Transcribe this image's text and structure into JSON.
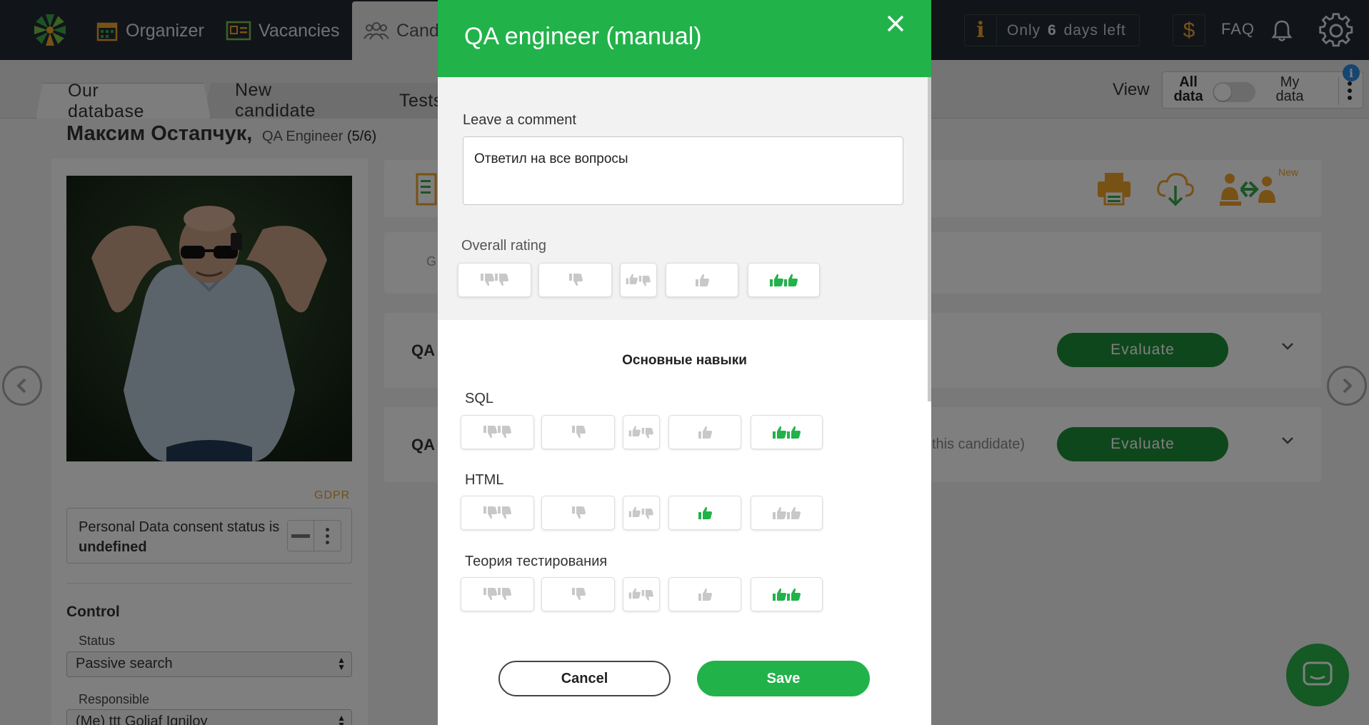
{
  "nav": {
    "items": [
      {
        "label": "Organizer",
        "icon": "calendar-icon"
      },
      {
        "label": "Vacancies",
        "icon": "id-card-icon"
      },
      {
        "label": "Cand",
        "icon": "people-icon"
      }
    ],
    "trial": {
      "prefix": "Only",
      "days": "6",
      "suffix": "days left"
    },
    "faq": "FAQ"
  },
  "tabs": [
    "Our database",
    "New candidate",
    "Tests"
  ],
  "view": {
    "label": "View",
    "all": "All data",
    "my": "My data"
  },
  "candidate": {
    "name": "Максим Остапчук,",
    "position": "QA Engineer",
    "stage": "(5/6)",
    "gdpr": "GDPR",
    "consent_prefix": "Personal Data consent status is",
    "consent_value": "undefined",
    "control_title": "Control",
    "status_label": "Status",
    "status_value": "Passive search",
    "responsible_label": "Responsible",
    "responsible_value": "(Me) ttt Goliaf Igniloy"
  },
  "cards": [
    {
      "label": "QA",
      "button": "Evaluate",
      "note": ""
    },
    {
      "label": "QA",
      "button": "Evaluate",
      "note": "this candidate)"
    }
  ],
  "card_placeholder_letter": "G",
  "modal": {
    "title": "QA engineer (manual)",
    "comment_label": "Leave a comment",
    "comment_value": "Ответил на все вопросы",
    "overall_label": "Overall rating",
    "overall_selected": 5,
    "section_title": "Основные навыки",
    "skills": [
      {
        "name": "SQL",
        "selected": 5
      },
      {
        "name": "HTML",
        "selected": 4
      },
      {
        "name": "Теория тестирования",
        "selected": 5
      }
    ],
    "cancel": "Cancel",
    "save": "Save"
  },
  "toolbar_new_badge": "New",
  "colors": {
    "brand_green": "#22b24a",
    "dark_green": "#1e8f39",
    "accent_orange": "#f0a32a",
    "topbar": "#232a33"
  }
}
